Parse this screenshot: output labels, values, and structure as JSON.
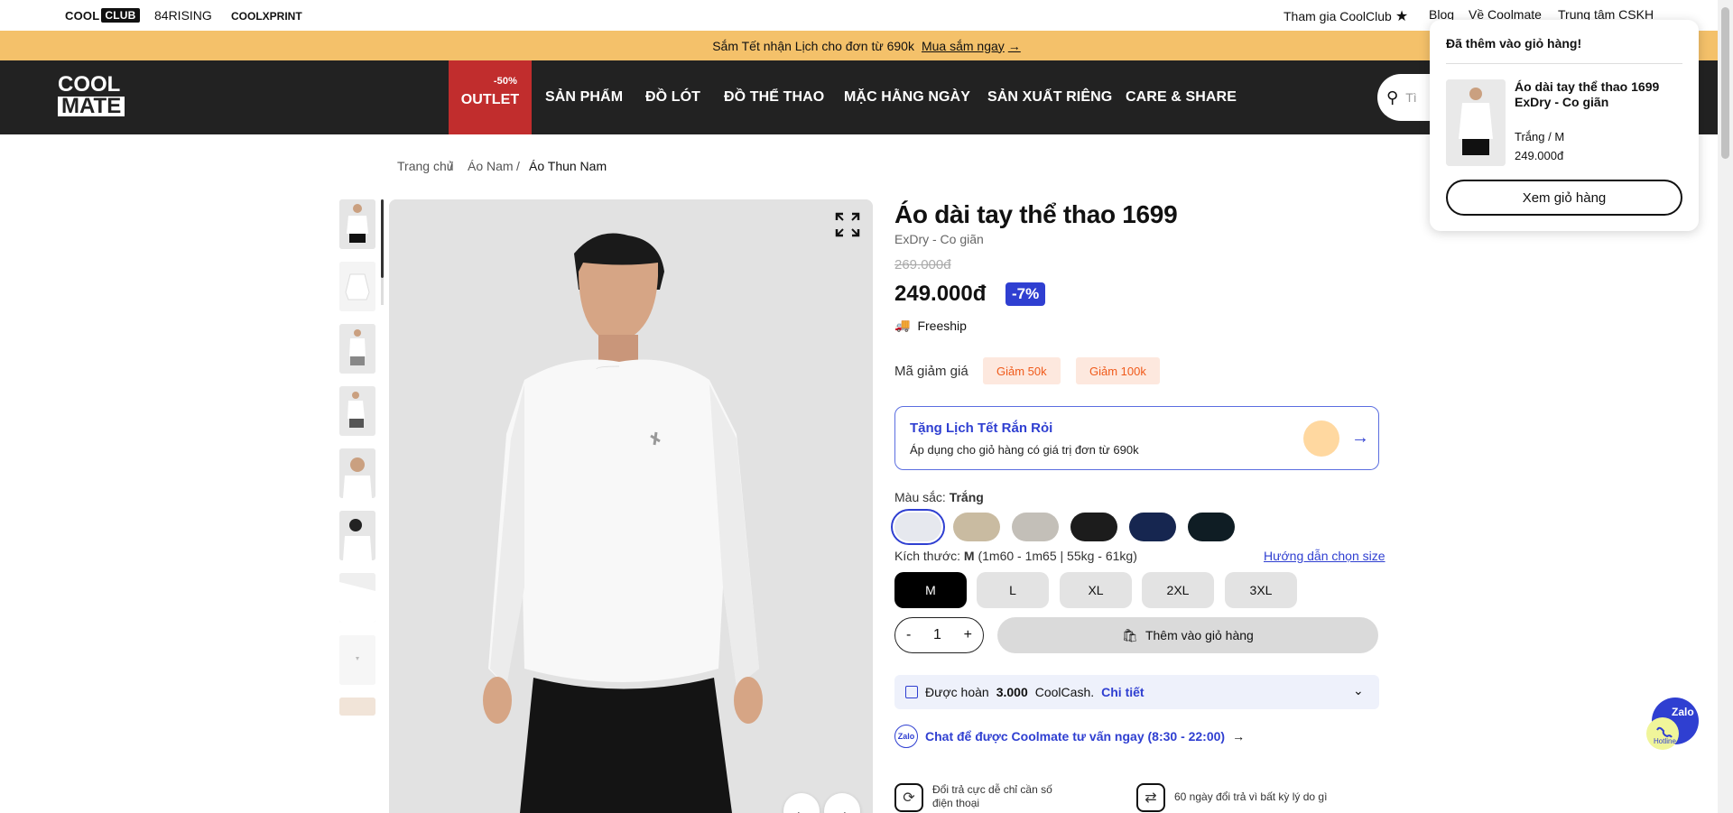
{
  "topbar": {
    "brands": [
      "COOL",
      "CLUB",
      "84RISING",
      "COOLXPRINT"
    ],
    "links": [
      "Tham gia CoolClub",
      "Blog",
      "Về Coolmate",
      "Trung tâm CSKH"
    ]
  },
  "announcement": {
    "text": "Sắm Tết nhận Lịch cho đơn từ 690k",
    "cta": "Mua sắm ngay"
  },
  "nav": {
    "logo_top": "COOL",
    "logo_bottom": "MATE",
    "outlet_tag": "-50%",
    "items": [
      "OUTLET",
      "SẢN PHẨM",
      "ĐỒ LÓT",
      "ĐỒ THỂ THAO",
      "MẶC HẰNG NGÀY",
      "SẢN XUẤT RIÊNG",
      "CARE & SHARE"
    ],
    "search_placeholder": "Tì"
  },
  "breadcrumb": [
    "Trang chủ",
    "/",
    "Áo Nam",
    "/",
    "Áo Thun Nam"
  ],
  "product": {
    "title": "Áo dài tay thể thao 1699",
    "subtitle": "ExDry - Co giãn",
    "old_price": "269.000đ",
    "price": "249.000đ",
    "discount": "-7%",
    "freeship": "Freeship",
    "voucher_label": "Mã giảm giá",
    "vouchers": [
      "Giảm 50k",
      "Giảm 100k"
    ],
    "promo_title": "Tặng Lịch Tết Rắn Rỏi",
    "promo_desc": "Áp dụng cho giỏ hàng có giá trị đơn từ 690k",
    "color_label": "Màu sắc:",
    "color_value": "Trắng",
    "colors": [
      "#e6e8ee",
      "#c9bba1",
      "#c3bfb8",
      "#1c1c1c",
      "#162650",
      "#0f1d24"
    ],
    "size_label": "Kích thước:",
    "size_value": "M",
    "size_hint": "(1m60 - 1m65 | 55kg - 61kg)",
    "size_guide": "Hướng dẫn chọn size",
    "sizes": [
      "M",
      "L",
      "XL",
      "2XL",
      "3XL"
    ],
    "qty_minus": "-",
    "qty": "1",
    "qty_plus": "+",
    "add_to_cart": "Thêm vào giỏ hàng",
    "coolcash_prefix": "Được hoàn",
    "coolcash_amount": "3.000",
    "coolcash_suffix": "CoolCash.",
    "coolcash_detail": "Chi tiết",
    "chat_badge": "Zalo",
    "chat_text": "Chat để được Coolmate tư vấn ngay (8:30 - 22:00)",
    "features": [
      "Đổi trả cực dễ chỉ cần số điện thoại",
      "60 ngày đổi trả vì bất kỳ lý do gì"
    ]
  },
  "cart_popup": {
    "header": "Đã thêm vào giỏ hàng!",
    "item_name": "Áo dài tay thể thao 1699 ExDry - Co giãn",
    "variant": "Trắng / M",
    "price": "249.000đ",
    "view_cart": "Xem giỏ hàng"
  },
  "fab": {
    "label": "Zalo",
    "sub": "Hotline"
  }
}
